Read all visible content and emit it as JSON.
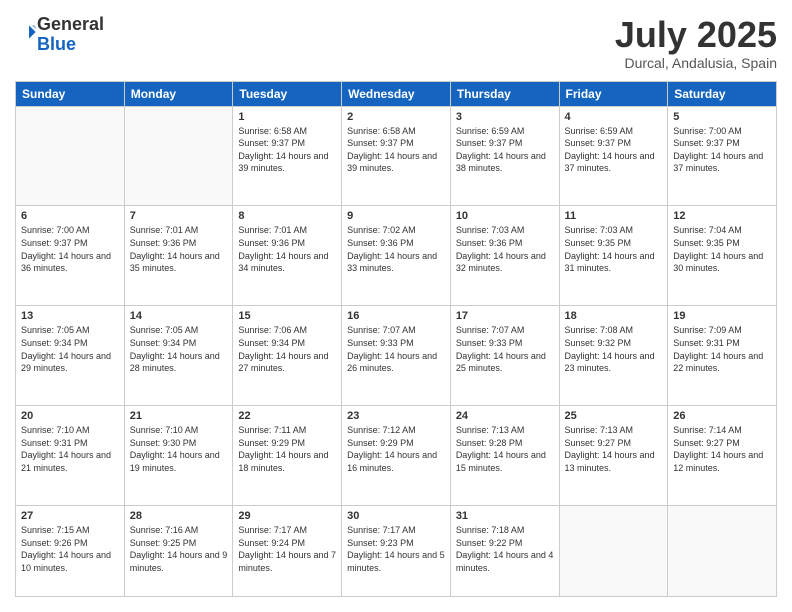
{
  "header": {
    "logo_general": "General",
    "logo_blue": "Blue",
    "month": "July 2025",
    "location": "Durcal, Andalusia, Spain"
  },
  "days_of_week": [
    "Sunday",
    "Monday",
    "Tuesday",
    "Wednesday",
    "Thursday",
    "Friday",
    "Saturday"
  ],
  "weeks": [
    [
      {
        "day": "",
        "info": ""
      },
      {
        "day": "",
        "info": ""
      },
      {
        "day": "1",
        "info": "Sunrise: 6:58 AM\nSunset: 9:37 PM\nDaylight: 14 hours and 39 minutes."
      },
      {
        "day": "2",
        "info": "Sunrise: 6:58 AM\nSunset: 9:37 PM\nDaylight: 14 hours and 39 minutes."
      },
      {
        "day": "3",
        "info": "Sunrise: 6:59 AM\nSunset: 9:37 PM\nDaylight: 14 hours and 38 minutes."
      },
      {
        "day": "4",
        "info": "Sunrise: 6:59 AM\nSunset: 9:37 PM\nDaylight: 14 hours and 37 minutes."
      },
      {
        "day": "5",
        "info": "Sunrise: 7:00 AM\nSunset: 9:37 PM\nDaylight: 14 hours and 37 minutes."
      }
    ],
    [
      {
        "day": "6",
        "info": "Sunrise: 7:00 AM\nSunset: 9:37 PM\nDaylight: 14 hours and 36 minutes."
      },
      {
        "day": "7",
        "info": "Sunrise: 7:01 AM\nSunset: 9:36 PM\nDaylight: 14 hours and 35 minutes."
      },
      {
        "day": "8",
        "info": "Sunrise: 7:01 AM\nSunset: 9:36 PM\nDaylight: 14 hours and 34 minutes."
      },
      {
        "day": "9",
        "info": "Sunrise: 7:02 AM\nSunset: 9:36 PM\nDaylight: 14 hours and 33 minutes."
      },
      {
        "day": "10",
        "info": "Sunrise: 7:03 AM\nSunset: 9:36 PM\nDaylight: 14 hours and 32 minutes."
      },
      {
        "day": "11",
        "info": "Sunrise: 7:03 AM\nSunset: 9:35 PM\nDaylight: 14 hours and 31 minutes."
      },
      {
        "day": "12",
        "info": "Sunrise: 7:04 AM\nSunset: 9:35 PM\nDaylight: 14 hours and 30 minutes."
      }
    ],
    [
      {
        "day": "13",
        "info": "Sunrise: 7:05 AM\nSunset: 9:34 PM\nDaylight: 14 hours and 29 minutes."
      },
      {
        "day": "14",
        "info": "Sunrise: 7:05 AM\nSunset: 9:34 PM\nDaylight: 14 hours and 28 minutes."
      },
      {
        "day": "15",
        "info": "Sunrise: 7:06 AM\nSunset: 9:34 PM\nDaylight: 14 hours and 27 minutes."
      },
      {
        "day": "16",
        "info": "Sunrise: 7:07 AM\nSunset: 9:33 PM\nDaylight: 14 hours and 26 minutes."
      },
      {
        "day": "17",
        "info": "Sunrise: 7:07 AM\nSunset: 9:33 PM\nDaylight: 14 hours and 25 minutes."
      },
      {
        "day": "18",
        "info": "Sunrise: 7:08 AM\nSunset: 9:32 PM\nDaylight: 14 hours and 23 minutes."
      },
      {
        "day": "19",
        "info": "Sunrise: 7:09 AM\nSunset: 9:31 PM\nDaylight: 14 hours and 22 minutes."
      }
    ],
    [
      {
        "day": "20",
        "info": "Sunrise: 7:10 AM\nSunset: 9:31 PM\nDaylight: 14 hours and 21 minutes."
      },
      {
        "day": "21",
        "info": "Sunrise: 7:10 AM\nSunset: 9:30 PM\nDaylight: 14 hours and 19 minutes."
      },
      {
        "day": "22",
        "info": "Sunrise: 7:11 AM\nSunset: 9:29 PM\nDaylight: 14 hours and 18 minutes."
      },
      {
        "day": "23",
        "info": "Sunrise: 7:12 AM\nSunset: 9:29 PM\nDaylight: 14 hours and 16 minutes."
      },
      {
        "day": "24",
        "info": "Sunrise: 7:13 AM\nSunset: 9:28 PM\nDaylight: 14 hours and 15 minutes."
      },
      {
        "day": "25",
        "info": "Sunrise: 7:13 AM\nSunset: 9:27 PM\nDaylight: 14 hours and 13 minutes."
      },
      {
        "day": "26",
        "info": "Sunrise: 7:14 AM\nSunset: 9:27 PM\nDaylight: 14 hours and 12 minutes."
      }
    ],
    [
      {
        "day": "27",
        "info": "Sunrise: 7:15 AM\nSunset: 9:26 PM\nDaylight: 14 hours and 10 minutes."
      },
      {
        "day": "28",
        "info": "Sunrise: 7:16 AM\nSunset: 9:25 PM\nDaylight: 14 hours and 9 minutes."
      },
      {
        "day": "29",
        "info": "Sunrise: 7:17 AM\nSunset: 9:24 PM\nDaylight: 14 hours and 7 minutes."
      },
      {
        "day": "30",
        "info": "Sunrise: 7:17 AM\nSunset: 9:23 PM\nDaylight: 14 hours and 5 minutes."
      },
      {
        "day": "31",
        "info": "Sunrise: 7:18 AM\nSunset: 9:22 PM\nDaylight: 14 hours and 4 minutes."
      },
      {
        "day": "",
        "info": ""
      },
      {
        "day": "",
        "info": ""
      }
    ]
  ]
}
